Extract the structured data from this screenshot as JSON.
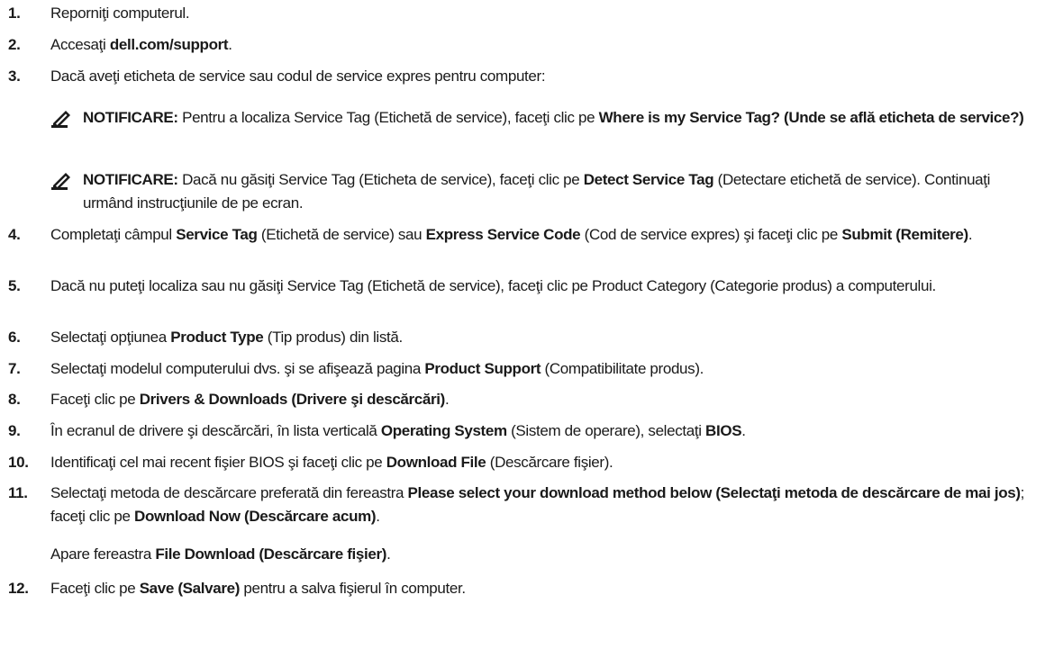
{
  "steps": [
    {
      "num": "1.",
      "parts": [
        {
          "t": "Reporniţi computerul."
        }
      ]
    },
    {
      "num": "2.",
      "parts": [
        {
          "t": "Accesaţi "
        },
        {
          "t": "dell.com/support",
          "b": true
        },
        {
          "t": "."
        }
      ]
    },
    {
      "num": "3.",
      "parts": [
        {
          "t": "Dacă aveţi eticheta de service sau codul de service expres pentru computer:"
        }
      ]
    },
    {
      "num": "4.",
      "parts": [
        {
          "t": "Completaţi câmpul "
        },
        {
          "t": "Service Tag",
          "b": true
        },
        {
          "t": " (Etichetă de service) sau "
        },
        {
          "t": "Express Service Code",
          "b": true
        },
        {
          "t": " (Cod de service expres) şi faceţi clic pe "
        },
        {
          "t": "Submit (Remitere)",
          "b": true
        },
        {
          "t": "."
        }
      ]
    },
    {
      "num": "5.",
      "parts": [
        {
          "t": "Dacă nu puteţi localiza sau nu găsiţi Service Tag (Etichetă de service), faceţi clic pe Product Category (Categorie produs) a computerului."
        }
      ]
    },
    {
      "num": "6.",
      "parts": [
        {
          "t": "Selectaţi opţiunea "
        },
        {
          "t": "Product Type",
          "b": true
        },
        {
          "t": " (Tip produs) din listă."
        }
      ]
    },
    {
      "num": "7.",
      "parts": [
        {
          "t": "Selectaţi modelul computerului dvs. şi se afişează pagina "
        },
        {
          "t": "Product Support",
          "b": true
        },
        {
          "t": " (Compatibilitate produs)."
        }
      ]
    },
    {
      "num": "8.",
      "parts": [
        {
          "t": "Faceţi clic pe "
        },
        {
          "t": "Drivers & Downloads (Drivere şi descărcări)",
          "b": true
        },
        {
          "t": "."
        }
      ]
    },
    {
      "num": "9.",
      "parts": [
        {
          "t": "În ecranul de drivere şi descărcări, în lista verticală "
        },
        {
          "t": "Operating System",
          "b": true
        },
        {
          "t": " (Sistem de operare), selectaţi "
        },
        {
          "t": "BIOS",
          "b": true
        },
        {
          "t": "."
        }
      ]
    },
    {
      "num": "10.",
      "parts": [
        {
          "t": "Identificaţi cel mai recent fişier BIOS şi faceţi clic pe "
        },
        {
          "t": "Download File",
          "b": true
        },
        {
          "t": " (Descărcare fişier)."
        }
      ]
    },
    {
      "num": "11.",
      "parts": [
        {
          "t": "Selectaţi metoda de descărcare preferată din fereastra "
        },
        {
          "t": "Please select your download method below (Selectaţi metoda de descărcare de mai jos)",
          "b": true
        },
        {
          "t": "; faceţi clic pe "
        },
        {
          "t": "Download Now (Descărcare acum)",
          "b": true
        },
        {
          "t": "."
        }
      ]
    },
    {
      "num": "12.",
      "parts": [
        {
          "t": "Faceţi clic pe "
        },
        {
          "t": "Save (Salvare)",
          "b": true
        },
        {
          "t": " pentru a salva fişierul în computer."
        }
      ]
    }
  ],
  "notes": [
    {
      "parts": [
        {
          "t": "NOTIFICARE:",
          "b": true
        },
        {
          "t": " Pentru a localiza Service Tag (Etichetă de service), faceţi clic pe "
        },
        {
          "t": "Where is my Service Tag? (Unde se află eticheta de service?)",
          "b": true
        }
      ]
    },
    {
      "parts": [
        {
          "t": "NOTIFICARE:",
          "b": true
        },
        {
          "t": " Dacă nu găsiţi Service Tag (Eticheta de service), faceţi clic pe "
        },
        {
          "t": "Detect Service Tag",
          "b": true
        },
        {
          "t": " (Detectare etichetă de service). Continuaţi urmând instrucţiunile de pe ecran."
        }
      ]
    }
  ],
  "step11_followup": {
    "parts": [
      {
        "t": "Apare fereastra "
      },
      {
        "t": "File Download (Descărcare fişier)",
        "b": true
      },
      {
        "t": "."
      }
    ]
  },
  "colors": {
    "text": "#1a1a1a",
    "icon": "#1a1a1a"
  },
  "icons": {
    "note": "pencil-note-icon"
  }
}
